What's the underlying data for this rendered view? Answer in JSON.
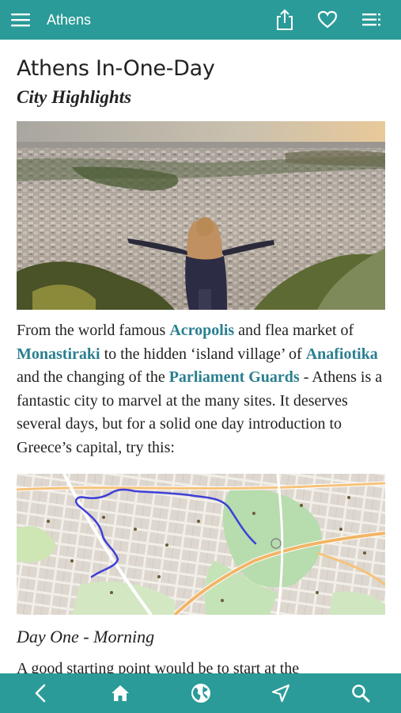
{
  "header": {
    "title": "Athens",
    "icons": [
      "menu-icon",
      "share-icon",
      "heart-icon",
      "list-icon"
    ]
  },
  "article": {
    "title": "Athens In-One-Day",
    "subtitle": "City Highlights",
    "intro": {
      "t1": "From the world famous ",
      "link_acropolis": "Acropolis",
      "t2": " and flea market of ",
      "link_monastiraki": "Monastiraki",
      "t3": " to the hidden ‘island village’ of ",
      "link_anafiotika": "Anafiotika",
      "t4": " and the changing of the ",
      "link_parliament": "Parliament Guards",
      "t5": " - Athens is a fantastic city to marvel at the many sites. It deserves several days, but for a solid one day introduction to Greece’s capital, try this:"
    },
    "section_heading": "Day One - Morning",
    "section_text": "A good starting point would be to start at the"
  },
  "bottom_nav": {
    "icons": [
      "back-icon",
      "home-icon",
      "globe-icon",
      "location-arrow-icon",
      "search-icon"
    ]
  },
  "colors": {
    "bar": "#2a9b98",
    "link": "#2a7f8f",
    "route": "#3f3fd8"
  }
}
